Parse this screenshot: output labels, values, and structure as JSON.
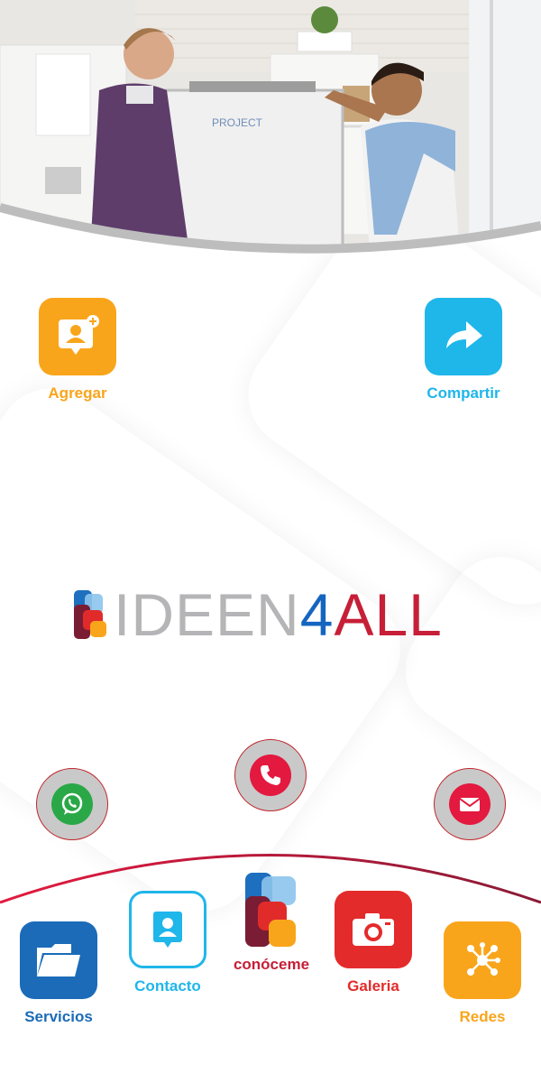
{
  "top_actions": {
    "add": {
      "label": "Agregar",
      "color": "#f9a51b",
      "icon": "add-contact-icon"
    },
    "share": {
      "label": "Compartir",
      "color": "#1fb6ea",
      "icon": "share-arrow-icon"
    }
  },
  "logo": {
    "part1": "IDEEN",
    "part2": "4",
    "part3": "ALL",
    "colors": {
      "gray": "#b5b5b7",
      "blue": "#1565c0",
      "red": "#c61f37"
    }
  },
  "quick_contacts": [
    {
      "name": "whatsapp",
      "icon": "whatsapp-icon",
      "color": "#2aa847"
    },
    {
      "name": "phone",
      "icon": "phone-icon",
      "color": "#e3193f"
    },
    {
      "name": "email",
      "icon": "email-icon",
      "color": "#e3193f"
    }
  ],
  "bottom_nav": {
    "servicios": {
      "label": "Servicios",
      "color": "#1b6bb8",
      "icon": "folder-icon"
    },
    "contacto": {
      "label": "Contacto",
      "color": "#1fb6ea",
      "icon": "contact-card-icon"
    },
    "conoceme": {
      "label": "conóceme",
      "color": "#c61f37",
      "icon": "brand-logo-icon"
    },
    "galeria": {
      "label": "Galeria",
      "color": "#e32b2b",
      "icon": "camera-icon"
    },
    "redes": {
      "label": "Redes",
      "color": "#f9a51b",
      "icon": "network-icon"
    }
  }
}
